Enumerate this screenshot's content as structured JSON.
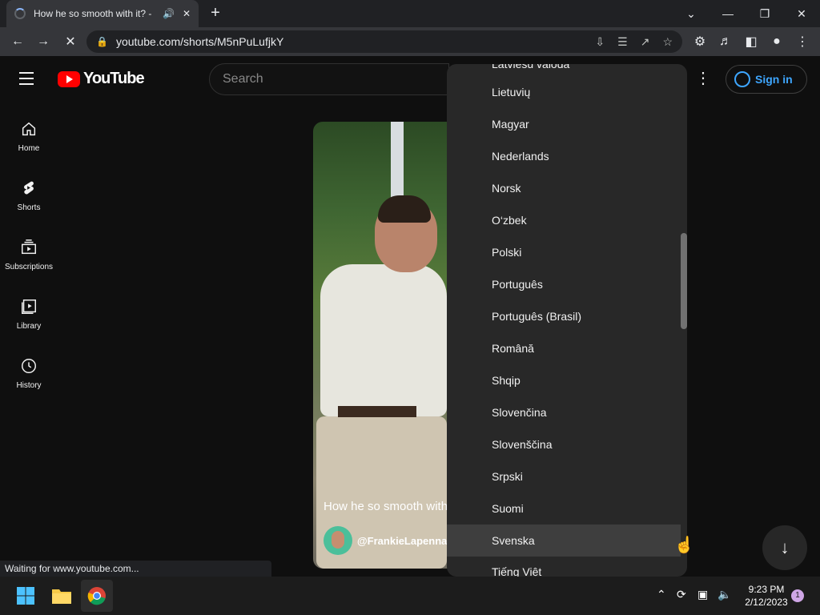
{
  "browser": {
    "tab_title": "How he so smooth with it? -",
    "new_tab": "+",
    "url": "youtube.com/shorts/M5nPuLufjkY",
    "status_text": "Waiting for www.youtube.com..."
  },
  "youtube": {
    "logo_text": "YouTube",
    "search_placeholder": "Search",
    "signin_label": "Sign in",
    "nav": [
      {
        "label": "Home",
        "icon": "home-icon"
      },
      {
        "label": "Shorts",
        "icon": "shorts-icon"
      },
      {
        "label": "Subscriptions",
        "icon": "subscriptions-icon"
      },
      {
        "label": "Library",
        "icon": "library-icon"
      },
      {
        "label": "History",
        "icon": "history-icon"
      }
    ],
    "video_caption": "How he so smooth with it?",
    "channel_name": "@FrankieLapenna",
    "language_menu": {
      "items": [
        "Latviešu valoda",
        "Lietuvių",
        "Magyar",
        "Nederlands",
        "Norsk",
        "O‘zbek",
        "Polski",
        "Português",
        "Português (Brasil)",
        "Română",
        "Shqip",
        "Slovenčina",
        "Slovenščina",
        "Srpski",
        "Suomi",
        "Svenska",
        "Tiếng Việt"
      ],
      "highlighted": "Svenska"
    }
  },
  "taskbar": {
    "time": "9:23 PM",
    "date": "2/12/2023",
    "notifications": "1"
  },
  "colors": {
    "accent_blue": "#3ea6ff",
    "youtube_red": "#ff0000",
    "menu_bg": "#282828"
  }
}
